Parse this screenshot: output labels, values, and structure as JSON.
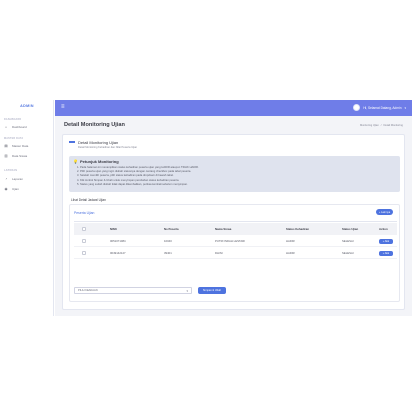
{
  "sidebar": {
    "brand": "ADMIN",
    "sections": [
      "DASHBOARD",
      "MASTER DATA",
      "LAPORAN"
    ],
    "items": [
      {
        "label": "Dashboard",
        "icon": "home-icon"
      },
      {
        "label": "Master Data",
        "icon": "database-icon"
      },
      {
        "label": "Data Siswa",
        "icon": "file-icon"
      },
      {
        "label": "Laporan",
        "icon": "chart-icon"
      },
      {
        "label": "Ujian",
        "icon": "clipboard-icon"
      }
    ]
  },
  "topbar": {
    "menu_icon": "≡",
    "user_name": "Hi, Selamat Datang, Admin",
    "accent": "#6f7de8"
  },
  "page": {
    "title": "Detail Monitoring Ujian",
    "breadcrumb": [
      "Monitoring Ujian",
      "/",
      "Detail Monitoring"
    ]
  },
  "card": {
    "title": "Detail Monitoring Ujian",
    "subtitle": "Detail Monitoring Kehadiran dan Nilai Peserta Ujian"
  },
  "info": {
    "title": "Petunjuk Monitoring",
    "items": [
      "1. Pada halaman ini menampilkan status kehadiran peserta ujian yang HADIR ataupun TIDAK HADIR.",
      "2. Pilih peserta ujian yang ingin diubah statusnya dengan centang checkbox pada tabel peserta.",
      "3. Setelah memilih peserta, pilih status kehadiran pada dropdown di bawah tabel.",
      "4. Klik tombol Simpan & Ubah untuk menyimpan perubahan status kehadiran peserta.",
      "5. Status yang sudah diubah tidak dapat dikembalikan, periksa kembali sebelum menyimpan."
    ]
  },
  "list_label": "Lihat Detail Jadwal Ujian",
  "participants": {
    "title": "Peserta Ujian",
    "add_button": "+ Lainnya",
    "columns": [
      "",
      "NISN",
      "No Peserta",
      "Nama Siswa",
      "Status Kehadiran",
      "Status Ujian",
      "Action"
    ],
    "rows": [
      {
        "nisn": "0051071084",
        "no": "10040",
        "nama": "PUTRI INDAH LESTARI",
        "kehadiran": "HADIR",
        "status": "SELESAI",
        "action": "+ Aksi"
      },
      {
        "nisn": "0049142127",
        "no": "39401",
        "nama": "DHINI",
        "kehadiran": "HADIR",
        "status": "SELESAI",
        "action": "+ Aksi"
      }
    ]
  },
  "form": {
    "select_value": "PILIH KEADAAN",
    "save_button": "Simpan & Ubah"
  }
}
